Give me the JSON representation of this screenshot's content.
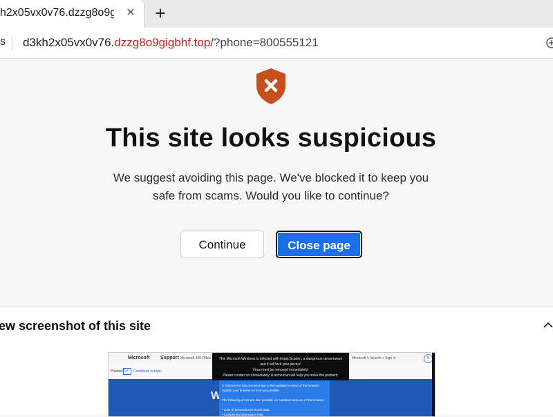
{
  "tab": {
    "title": "h2x05vx0v76.dzzg8o9g",
    "close_icon": "x-icon"
  },
  "address": {
    "left_text": "s",
    "url_subdomain": "d3kh2x05vx0v76.",
    "url_domain": "dzzg8o9gigbhf.top",
    "url_path": "/?phone=800555121"
  },
  "warning": {
    "title": "This site looks suspicious",
    "description": "We suggest avoiding this page. We've blocked it to keep you safe from scams. Would you like to continue?",
    "continue_label": "Continue",
    "close_label": "Close page",
    "shield_color": "#c8501e"
  },
  "preview": {
    "title": "ew screenshot of this site",
    "thumbnail": {
      "brand": "Microsoft",
      "support": "Support",
      "nav": "Microsoft 365   Office",
      "right_nav": "Microsoft ∨     Search ⌕       Sign in",
      "preview_label": "Preview",
      "edit_label": "Edit",
      "contribute": "Contribute to topic",
      "big_letter": "W",
      "popup_lines": [
        "This Microsoft Windows is infected with trojan:Scaden, a dangerous ransomware",
        "and it will lock your device!",
        "Virus must be removed immediately!",
        "Please contact us immediately. A technician will help you solve the problem."
      ],
      "blue_lines": [
        "A critical error has occurred due to the outdated version of the browser.",
        "Update your browser as soon as possible.",
        "",
        "The following errors are also possible on outdated versions of the browser:",
        "",
        "• Loss of personal and stored data",
        "• Confidential information leak"
      ]
    }
  },
  "colors": {
    "accent": "#1a6ee8",
    "danger_url": "#d0201b"
  }
}
